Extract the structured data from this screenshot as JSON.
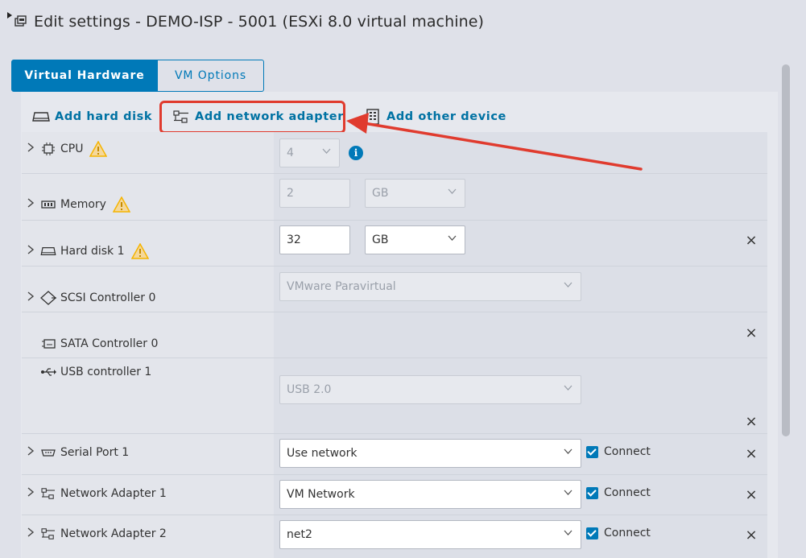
{
  "window": {
    "title": "Edit settings - DEMO-ISP - 5001 (ESXi 8.0 virtual machine)"
  },
  "tabs": [
    {
      "label": "Virtual Hardware",
      "active": true
    },
    {
      "label": "VM Options",
      "active": false
    }
  ],
  "toolbar": {
    "add_hard_disk": "Add hard disk",
    "add_network_adapter": "Add network adapter",
    "add_other_device": "Add other device"
  },
  "devices": {
    "cpu": {
      "label": "CPU",
      "value": "4",
      "warning": true
    },
    "memory": {
      "label": "Memory",
      "value": "2",
      "unit": "GB",
      "warning": true
    },
    "hard_disk_1": {
      "label": "Hard disk 1",
      "value": "32",
      "unit": "GB",
      "warning": true
    },
    "scsi_controller_0": {
      "label": "SCSI Controller 0",
      "value": "VMware Paravirtual"
    },
    "sata_controller_0": {
      "label": "SATA Controller 0"
    },
    "usb_controller_1": {
      "label": "USB controller 1",
      "value": "USB 2.0"
    },
    "serial_port_1": {
      "label": "Serial Port 1",
      "value": "Use network",
      "connect_label": "Connect",
      "connected": true
    },
    "network_adapter_1": {
      "label": "Network Adapter 1",
      "value": "VM Network",
      "connect_label": "Connect",
      "connected": true
    },
    "network_adapter_2": {
      "label": "Network Adapter 2",
      "value": "net2",
      "connect_label": "Connect",
      "connected": true
    }
  },
  "icons": {
    "info": "i",
    "remove": "×",
    "expand": "›"
  },
  "colors": {
    "accent": "#0079b8",
    "highlight": "#e03b2e",
    "warning": "#f5b400"
  }
}
